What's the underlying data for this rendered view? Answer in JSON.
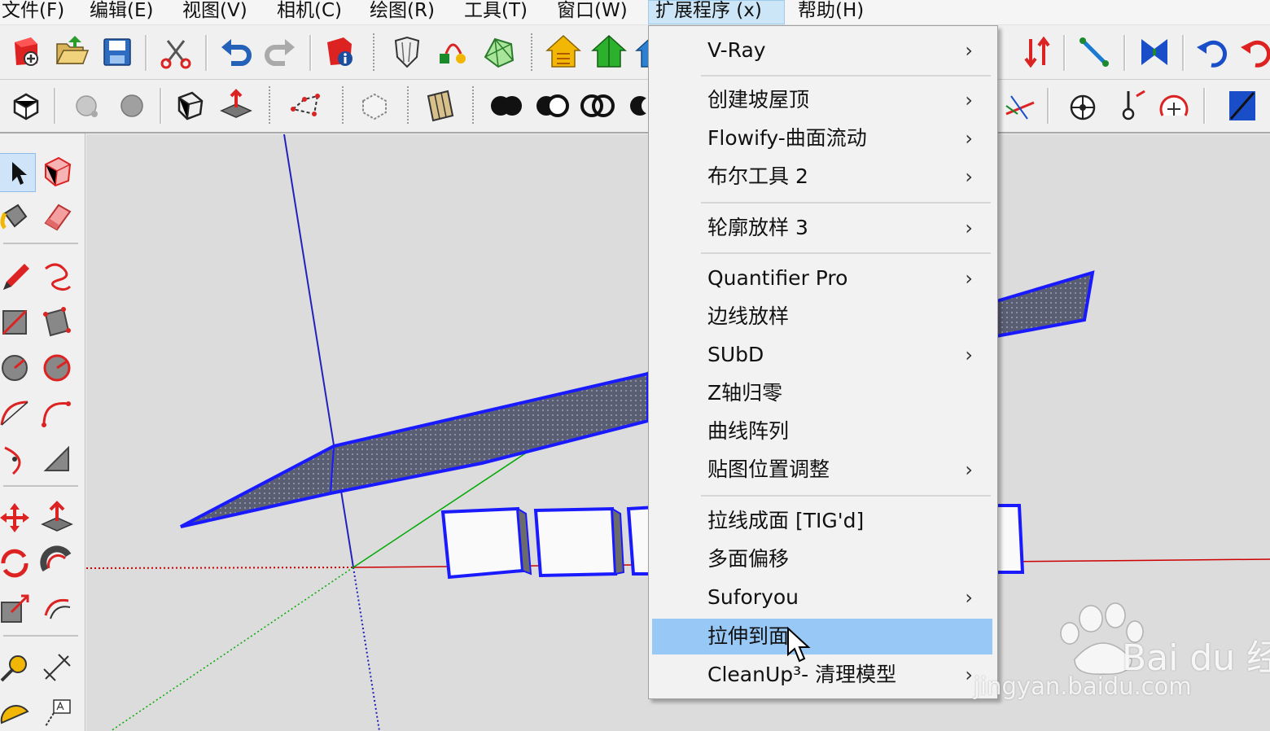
{
  "menubar": {
    "items": [
      {
        "label": "文件(F)"
      },
      {
        "label": "编辑(E)"
      },
      {
        "label": "视图(V)"
      },
      {
        "label": "相机(C)"
      },
      {
        "label": "绘图(R)"
      },
      {
        "label": "工具(T)"
      },
      {
        "label": "窗口(W)"
      },
      {
        "label": "扩展程序 (x)",
        "active": true
      },
      {
        "label": "帮助(H)"
      }
    ]
  },
  "extensions_menu": {
    "items": [
      {
        "label": "V-Ray",
        "submenu": true
      },
      {
        "label": "创建坡屋顶",
        "submenu": true
      },
      {
        "label": "Flowify-曲面流动",
        "submenu": true
      },
      {
        "label": "布尔工具 2",
        "submenu": true
      },
      {
        "label": "轮廓放样 3",
        "submenu": true
      },
      {
        "label": "Quantifier Pro",
        "submenu": true
      },
      {
        "label": "边线放样",
        "submenu": false
      },
      {
        "label": "SUbD",
        "submenu": true
      },
      {
        "label": "Z轴归零",
        "submenu": false
      },
      {
        "label": "曲线阵列",
        "submenu": false
      },
      {
        "label": "贴图位置调整",
        "submenu": true
      },
      {
        "label": "拉线成面 [TIG'd]",
        "submenu": false
      },
      {
        "label": "多面偏移",
        "submenu": false
      },
      {
        "label": "Suforyou",
        "submenu": true
      },
      {
        "label": "拉伸到面",
        "submenu": false,
        "highlighted": true
      },
      {
        "label": "CleanUp³- 清理模型",
        "submenu": true
      }
    ],
    "submenu_glyph": "›"
  },
  "watermark": {
    "brand": "Bai du 经验",
    "url": "jingyan.baidu.com"
  },
  "colors": {
    "menu_highlight": "#98c8f5",
    "menubar_active": "#cde6f7",
    "selection_blue": "#1a1aff",
    "face_fill": "#5a5e72",
    "axis_red": "#cc0000",
    "axis_green": "#00aa00",
    "axis_blue": "#0000cc"
  },
  "icons": {
    "toolbar1": [
      "new-model-icon",
      "open-icon",
      "save-icon",
      "cut-icon",
      "undo-icon",
      "redo-icon",
      "model-info-icon",
      "shield-icon",
      "paint-bucket-icon",
      "sandbox-icon",
      "house-yellow-icon",
      "house-green-icon",
      "house-blue-icon",
      "flip-arrows-icon",
      "move-axis-icon",
      "mirror-icon",
      "rotate-arrow-icon",
      "rotate-red-icon"
    ],
    "toolbar2": [
      "orbit-icon",
      "shadow-off-icon",
      "shadow-on-icon",
      "section-icon",
      "push-pull-face-icon",
      "dashed-polygon-icon",
      "component-icon",
      "material-icon",
      "solid-union-icon",
      "solid-subtract-icon",
      "solid-intersect-icon",
      "solid-trim-icon",
      "axes-icon",
      "position-camera-icon",
      "look-around-icon",
      "walk-icon",
      "section-plane-icon"
    ],
    "palette": [
      "select-icon",
      "make-component-icon",
      "paint-bucket-icon",
      "eraser-icon",
      "pencil-icon",
      "freehand-icon",
      "rectangle-icon",
      "rotated-rectangle-icon",
      "circle-icon",
      "polygon-icon",
      "arc-icon",
      "two-point-arc-icon",
      "three-point-arc-icon",
      "pie-icon",
      "move-icon",
      "push-pull-icon",
      "rotate-icon",
      "follow-me-icon",
      "scale-icon",
      "offset-icon",
      "tape-measure-icon",
      "dimension-icon",
      "protractor-icon",
      "text-icon"
    ]
  }
}
